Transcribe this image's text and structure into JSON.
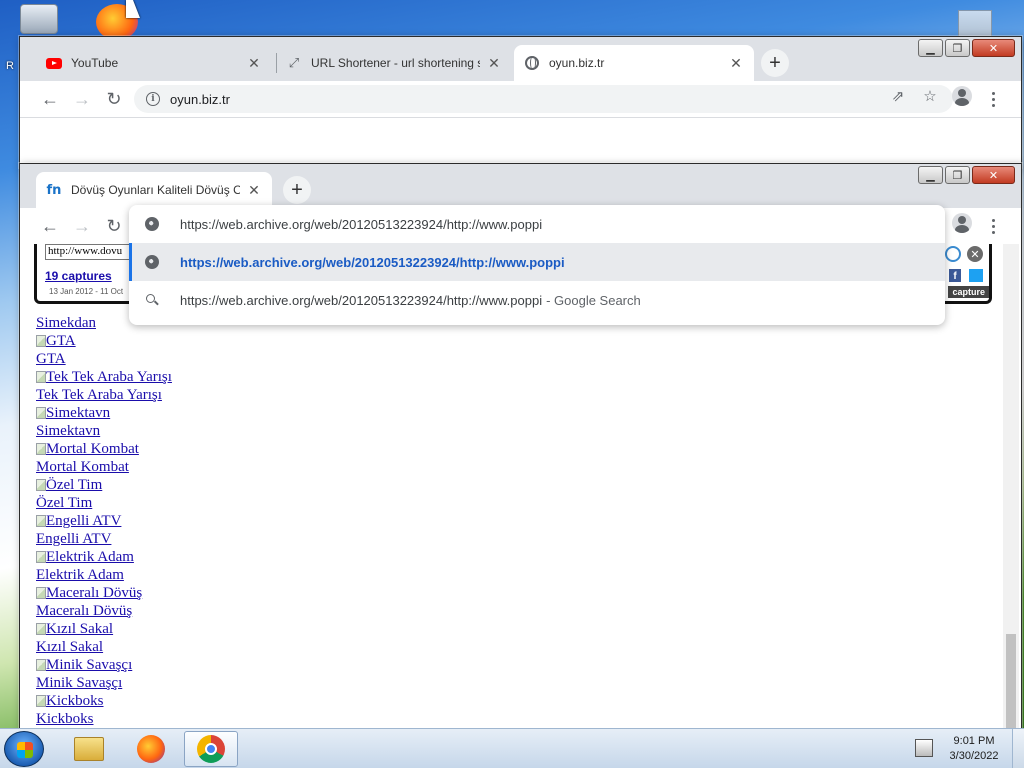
{
  "desktop": {
    "left_label": "R"
  },
  "back_window": {
    "tabs": [
      {
        "title": "YouTube",
        "favicon": "youtube-icon"
      },
      {
        "title": "URL Shortener - url shortening s",
        "favicon": "link-icon"
      },
      {
        "title": "oyun.biz.tr",
        "favicon": "globe-icon"
      }
    ],
    "address": "oyun.biz.tr"
  },
  "front_window": {
    "tab": {
      "title": "Dövüş Oyunları Kaliteli Dövüş Oy",
      "favicon": "fn"
    },
    "address_input": "https://web.archive.org/web/20120513223924/http://www.poppi",
    "suggestions": [
      {
        "text": "https://web.archive.org/web/20120513223924/http://www.poppi",
        "kind": "url"
      },
      {
        "text": "https://web.archive.org/web/20120513223924/http://www.poppi",
        "suffix": "- Google Search",
        "kind": "search"
      }
    ],
    "wayback": {
      "url_field": "http://www.dovu",
      "captures": "19 captures",
      "range": "13 Jan 2012 - 11 Oct",
      "fb": "f",
      "capture_btn": "capture"
    },
    "partial_link": "Simekdan",
    "games": [
      "GTA",
      "Tek Tek Araba Yarışı",
      "Simektavn",
      "Mortal Kombat",
      "Özel Tim",
      "Engelli ATV",
      "Elektrik Adam",
      "Maceralı Dövüş",
      "Kızıl Sakal",
      "Minik Savaşçı",
      "Kickboks"
    ]
  },
  "taskbar": {
    "time": "9:01 PM",
    "date": "3/30/2022",
    "apps": [
      "windows-explorer",
      "firefox",
      "chrome"
    ]
  }
}
